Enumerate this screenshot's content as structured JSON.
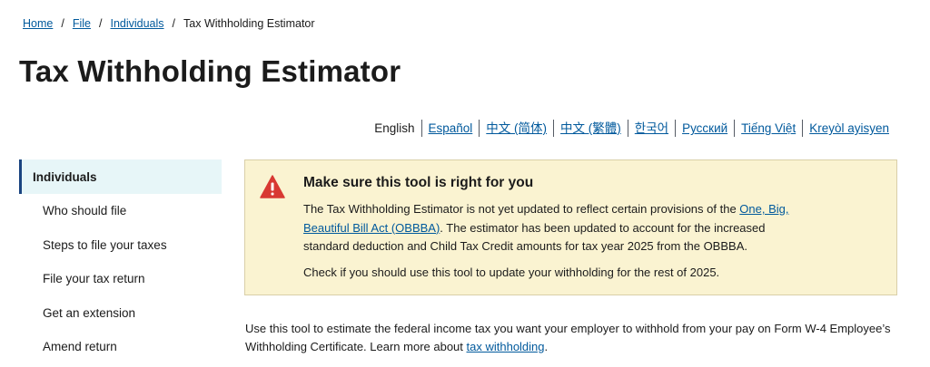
{
  "breadcrumb": {
    "home": "Home",
    "file": "File",
    "individuals": "Individuals",
    "current": "Tax Withholding Estimator",
    "separator": "/"
  },
  "page_title": "Tax Withholding Estimator",
  "languages": [
    "English",
    "Español",
    "中文 (简体)",
    "中文 (繁體)",
    "한국어",
    "Русский",
    "Tiếng Việt",
    "Kreyòl ayisyen"
  ],
  "sidenav": {
    "active": "Individuals",
    "items": [
      "Who should file",
      "Steps to file your taxes",
      "File your tax return",
      "Get an extension",
      "Amend return"
    ]
  },
  "alert": {
    "icon": "warning-triangle-icon",
    "icon_color": "#d83933",
    "heading": "Make sure this tool is right for you",
    "p1_before": "The Tax Withholding Estimator is not yet updated to reflect certain provisions of the ",
    "p1_link": "One, Big, Beautiful Bill Act (OBBBA)",
    "p1_after": ". The estimator has been updated to account for the increased standard deduction and Child Tax Credit amounts for tax year 2025 from the OBBBA.",
    "p2": "Check if you should use this tool to update your withholding for the rest of 2025."
  },
  "intro": {
    "before": "Use this tool to estimate the federal income tax you want your employer to withhold from your pay on Form W-4 Employee’s Withholding Certificate. Learn more about ",
    "link": "tax withholding",
    "after": "."
  }
}
